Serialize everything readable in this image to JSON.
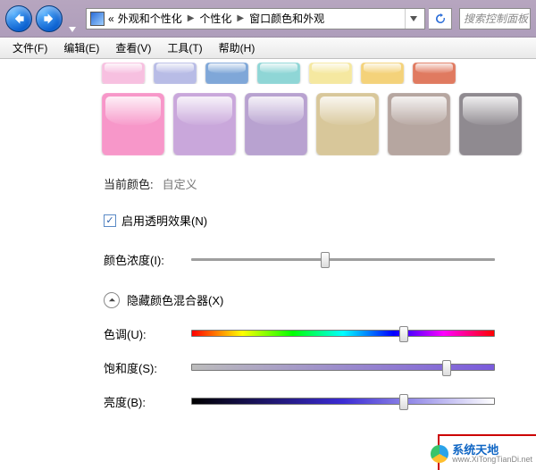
{
  "titlebar": {
    "breadcrumb_prefix": "«",
    "breadcrumb": [
      "外观和个性化",
      "个性化",
      "窗口颜色和外观"
    ],
    "search_placeholder": "搜索控制面板"
  },
  "menubar": {
    "items": [
      "文件(F)",
      "编辑(E)",
      "查看(V)",
      "工具(T)",
      "帮助(H)"
    ]
  },
  "swatches": {
    "row1_colors": [
      "#f7c0e0",
      "#b8bce6",
      "#7fa7d8",
      "#8fd6d6",
      "#f5e8a0",
      "#f4d27a",
      "#e07a60"
    ],
    "row2_colors": [
      "#f797c9",
      "#c9a7db",
      "#b8a2d0",
      "#d8c79a",
      "#b6a6a0",
      "#8f8a90"
    ]
  },
  "current_color": {
    "label": "当前颜色:",
    "value": "自定义"
  },
  "transparency": {
    "checked": true,
    "label": "启用透明效果(N)"
  },
  "intensity": {
    "label": "颜色浓度(I):",
    "percent": 44
  },
  "mixer": {
    "header": "隐藏颜色混合器(X)",
    "hue": {
      "label": "色调(U):",
      "percent": 70
    },
    "saturation": {
      "label": "饱和度(S):",
      "percent": 84
    },
    "brightness": {
      "label": "亮度(B):",
      "percent": 70
    }
  },
  "watermark": {
    "title": "系统天地",
    "url": "www.XiTongTianDi.net"
  }
}
